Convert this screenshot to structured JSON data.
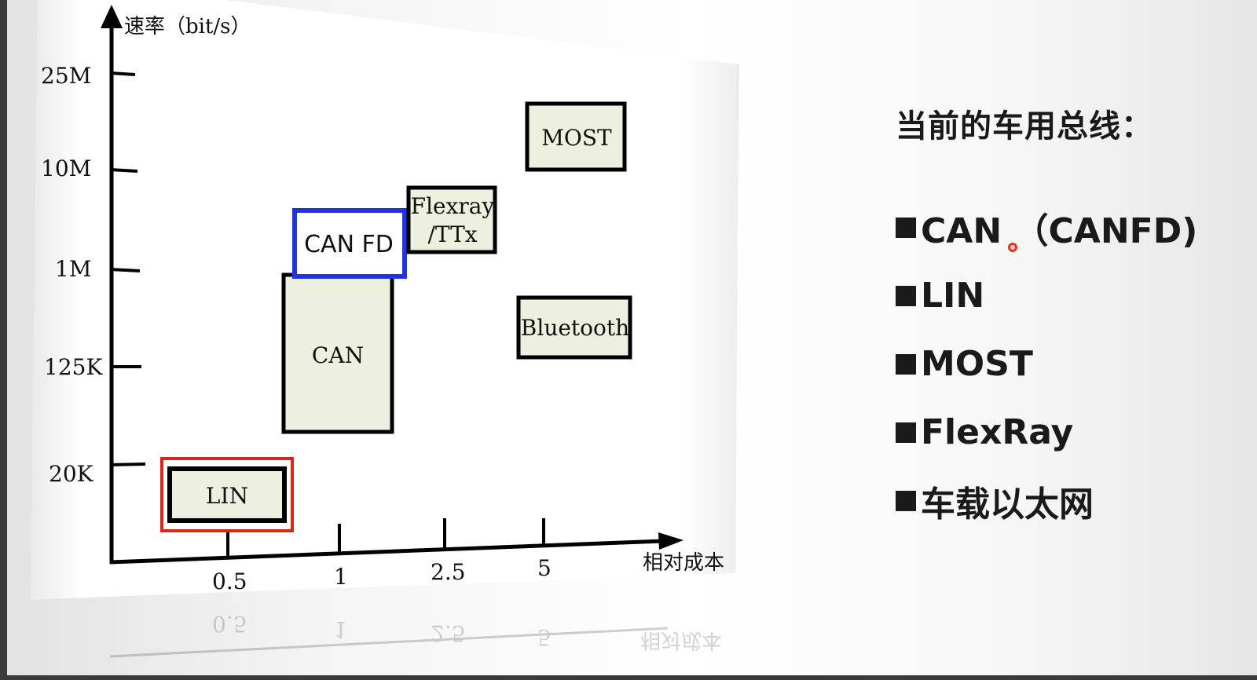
{
  "chart_data": {
    "type": "diagram",
    "y_axis_label": "速率（bit/s）",
    "x_axis_label": "相对成本",
    "y_ticks": [
      "25M",
      "10M",
      "1M",
      "125K",
      "20K"
    ],
    "x_ticks": [
      "0.5",
      "1",
      "2.5",
      "5"
    ],
    "boxes": [
      {
        "label": "LIN",
        "highlight_color": "#e0241b"
      },
      {
        "label": "CAN"
      },
      {
        "label": "CAN FD",
        "highlight_color": "#1f33e0"
      },
      {
        "label_lines": [
          "Flexray",
          "/TTx"
        ]
      },
      {
        "label": "MOST"
      },
      {
        "label": "Bluetooth"
      }
    ]
  },
  "panel": {
    "title": "当前的车用总线：",
    "items": [
      "CAN （CANFD)",
      "LIN",
      "MOST",
      "FlexRay",
      "车载以太网"
    ]
  },
  "colors": {
    "box_fill": "#eef0df",
    "highlight_red": "#e0241b",
    "highlight_blue": "#1f33e0",
    "text": "#1a1a1a"
  }
}
